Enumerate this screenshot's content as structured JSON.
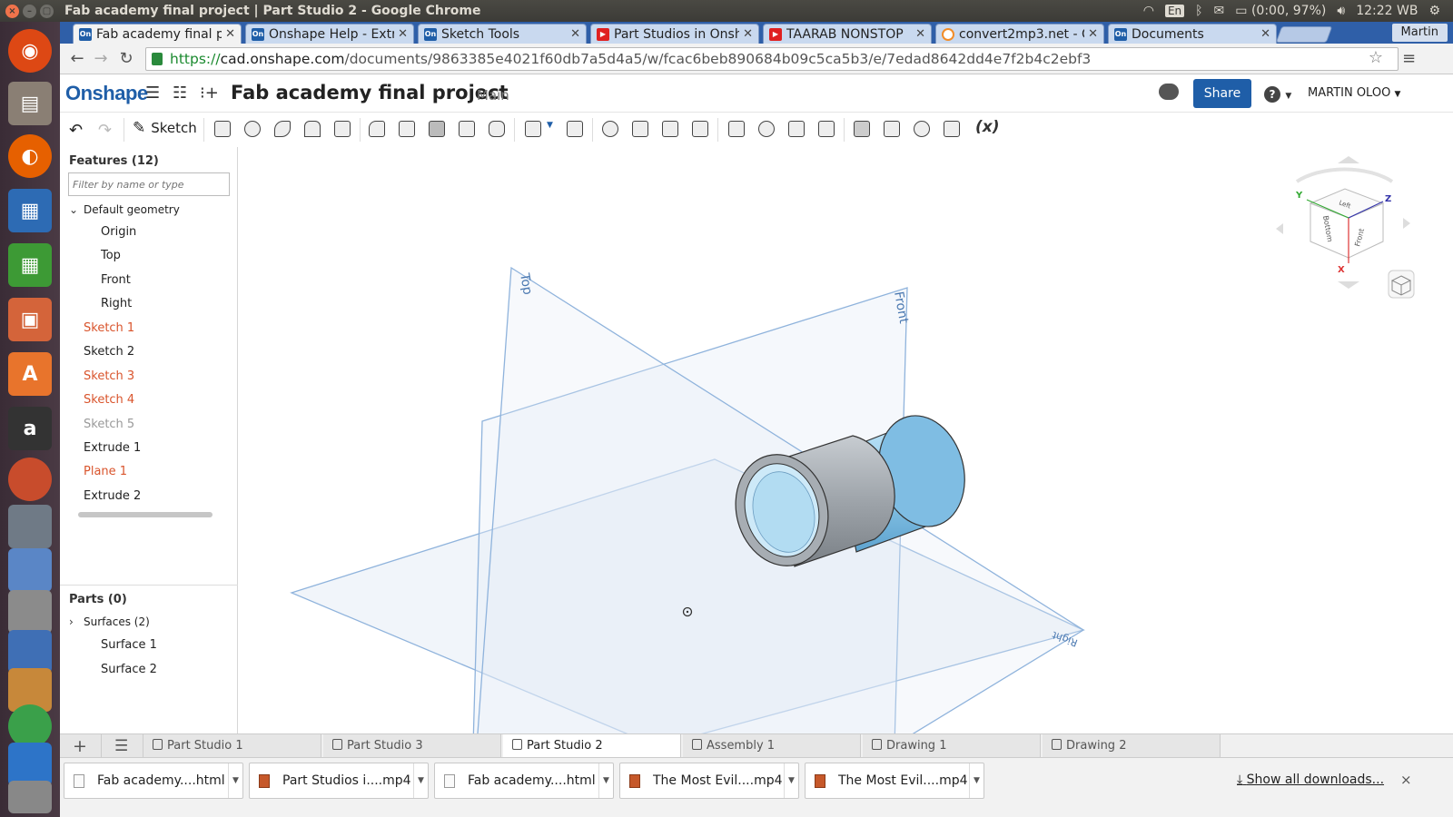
{
  "system": {
    "window_title": "Fab academy final project | Part Studio 2 - Google Chrome",
    "keyboard": "En",
    "battery": "(0:00, 97%)",
    "clock": "12:22 WB"
  },
  "browser": {
    "tabs": [
      {
        "label": "Fab academy final p",
        "favicon": "onshape-icon",
        "active": true
      },
      {
        "label": "Onshape Help - Extr",
        "favicon": "onshape-icon",
        "active": false
      },
      {
        "label": "Sketch Tools",
        "favicon": "onshape-icon",
        "active": false
      },
      {
        "label": "Part Studios in Onsh",
        "favicon": "youtube-icon",
        "active": false
      },
      {
        "label": "TAARAB NONSTOP",
        "favicon": "youtube-icon",
        "active": false
      },
      {
        "label": "convert2mp3.net - C",
        "favicon": "convert2mp3-icon",
        "active": false
      },
      {
        "label": "Documents",
        "favicon": "onshape-icon",
        "active": false
      }
    ],
    "profile": "Martin",
    "url": {
      "scheme": "https://",
      "host": "cad.onshape.com",
      "path": "/documents/9863385e4021f60db7a5d4a5/w/fcac6beb890684b09c5ca5b3/e/7edad8642dd4e7f2b4c2ebf3"
    }
  },
  "onshape": {
    "logo": "Onshape",
    "doc_title": "Fab academy final project",
    "workspace": "Main",
    "share_label": "Share",
    "help_label": "?",
    "user": "MARTIN OLOO",
    "toolbar": {
      "sketch_label": "Sketch",
      "variable_label": "(x)"
    },
    "features": {
      "title": "Features (12)",
      "filter_placeholder": "Filter by name or type",
      "default_geometry_label": "Default geometry",
      "items": [
        {
          "label": "Origin",
          "state": "normal"
        },
        {
          "label": "Top",
          "state": "normal"
        },
        {
          "label": "Front",
          "state": "normal"
        },
        {
          "label": "Right",
          "state": "normal"
        },
        {
          "label": "Sketch 1",
          "state": "error"
        },
        {
          "label": "Sketch 2",
          "state": "normal"
        },
        {
          "label": "Sketch 3",
          "state": "error"
        },
        {
          "label": "Sketch 4",
          "state": "error"
        },
        {
          "label": "Sketch 5",
          "state": "suppressed"
        },
        {
          "label": "Extrude 1",
          "state": "normal"
        },
        {
          "label": "Plane 1",
          "state": "error"
        },
        {
          "label": "Extrude 2",
          "state": "normal"
        }
      ]
    },
    "parts": {
      "title": "Parts (0)",
      "surfaces_label": "Surfaces (2)",
      "surfaces": [
        "Surface 1",
        "Surface 2"
      ]
    },
    "viewport": {
      "plane_labels": {
        "top": "Top",
        "front": "Front",
        "right": "Right"
      },
      "view_cube": {
        "left": "Left",
        "bottom": "Bottom",
        "front": "Front",
        "axis_x": "X",
        "axis_y": "Y",
        "axis_z": "Z"
      }
    },
    "bottom_tabs": [
      {
        "label": "Part Studio 1",
        "active": false
      },
      {
        "label": "Part Studio 3",
        "active": false
      },
      {
        "label": "Part Studio 2",
        "active": true
      },
      {
        "label": "Assembly 1",
        "active": false
      },
      {
        "label": "Drawing 1",
        "active": false
      },
      {
        "label": "Drawing 2",
        "active": false
      }
    ]
  },
  "downloads": {
    "items": [
      {
        "label": "Fab academy....html",
        "kind": "html"
      },
      {
        "label": "Part Studios i....mp4",
        "kind": "video"
      },
      {
        "label": "Fab academy....html",
        "kind": "html"
      },
      {
        "label": "The Most Evil....mp4",
        "kind": "video"
      },
      {
        "label": "The Most Evil....mp4",
        "kind": "video"
      }
    ],
    "show_all": "Show all downloads...",
    "close": "×"
  },
  "colors": {
    "accent": "#1f5ea8",
    "error_feature": "#d9542c",
    "plane_stroke": "#8fb3dc",
    "part_blue": "#8fcaea",
    "part_gray": "#9ea4aa"
  }
}
